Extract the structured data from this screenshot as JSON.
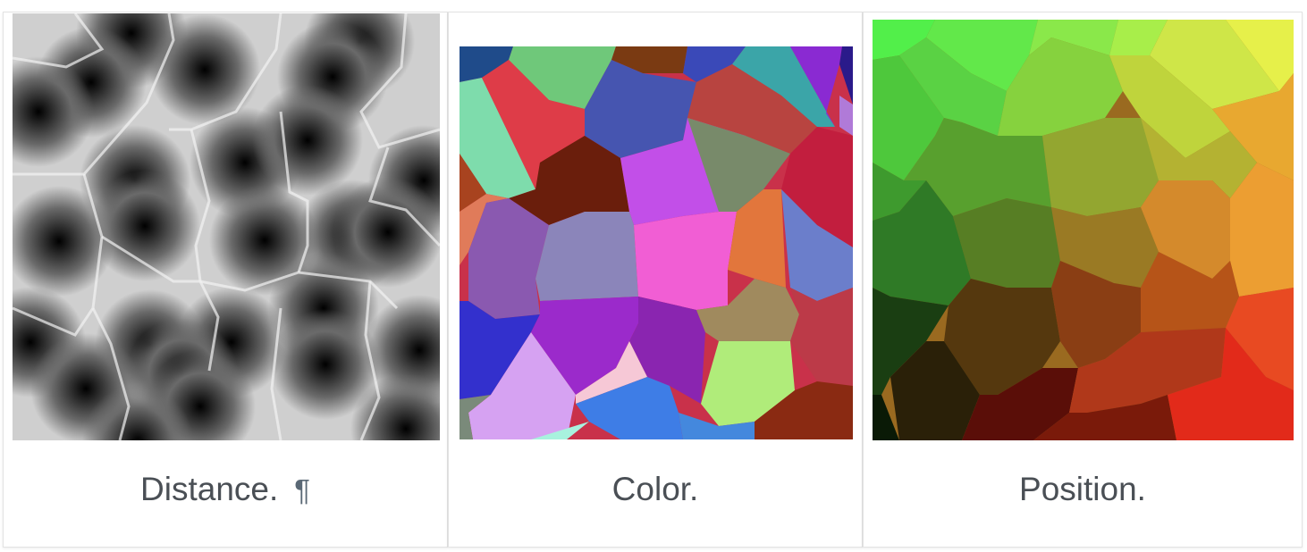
{
  "cards": [
    {
      "caption": "Distance.",
      "permalink_symbol": "¶",
      "image": "voronoi-distance-image"
    },
    {
      "caption": "Color.",
      "image": "voronoi-color-image"
    },
    {
      "caption": "Position.",
      "image": "voronoi-position-image"
    }
  ]
}
